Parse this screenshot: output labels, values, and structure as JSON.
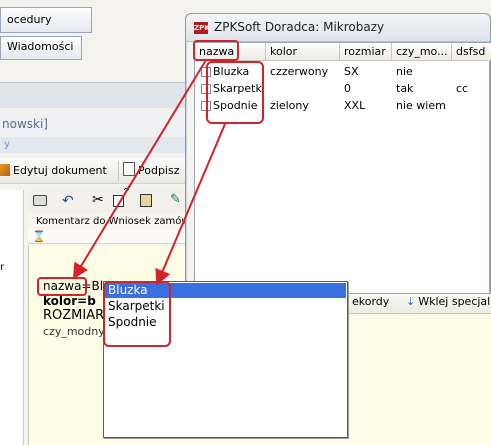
{
  "background_app": {
    "tabs": [
      "ocedury ogólne",
      "Wiadomości"
    ],
    "window_title_fragment": "nowski]",
    "edit_document_label": "Edytuj dokument",
    "sign_label": "Podpisz d",
    "editor_tabs": "Komentarz do  Wniosek zamów",
    "editor_lines": {
      "nazwa": "nazwa=",
      "nazwa_rest": "Blu",
      "kolor": "kolor=b",
      "rozmiar": "ROZMIAR",
      "czy_modny": "czy_modny"
    },
    "bottom_toolbar": {
      "records_label": "ekordy",
      "paste_special_label": "Wklej specjaln"
    }
  },
  "mikrobazy_window": {
    "title": "ZPKSoft Doradca: Mikrobazy",
    "columns": [
      "nazwa",
      "kolor",
      "rozmiar",
      "czy_mo...",
      "dsfsd"
    ],
    "rows": [
      {
        "nazwa": "Bluzka",
        "kolor": "czzerwony",
        "rozmiar": "SX",
        "czy_modny": "nie",
        "dsfsd": ""
      },
      {
        "nazwa": "Skarpetki",
        "kolor": "",
        "rozmiar": "0",
        "czy_modny": "tak",
        "dsfsd": "cc"
      },
      {
        "nazwa": "Spodnie",
        "kolor": "zielony",
        "rozmiar": "XXL",
        "czy_modny": "nie wiem",
        "dsfsd": ""
      }
    ]
  },
  "dropdown": {
    "items": [
      "Bluzka",
      "Skarpetki",
      "Spodnie"
    ],
    "selected_index": 0
  },
  "colors": {
    "annotation_red": "#d2232a",
    "selection_blue": "#3a6fe0",
    "editor_yellow": "#fffde6"
  }
}
